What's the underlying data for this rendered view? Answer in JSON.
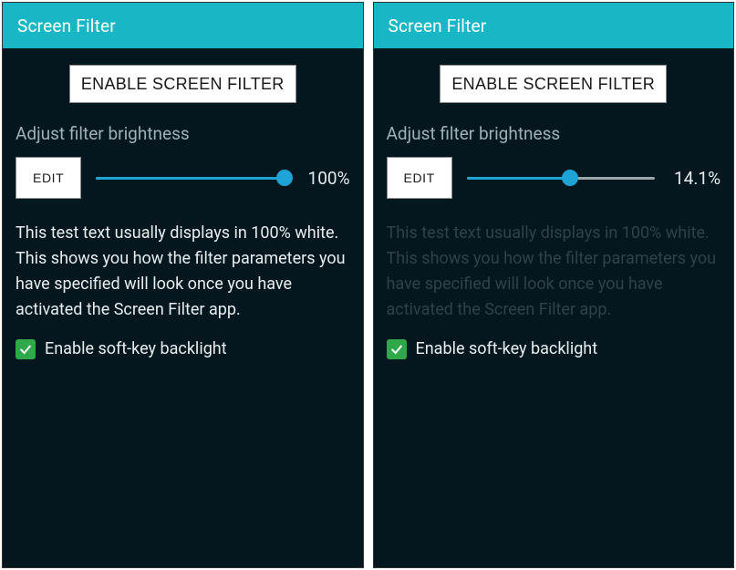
{
  "panels": [
    {
      "title": "Screen Filter",
      "enable_button": "ENABLE SCREEN FILTER",
      "brightness_label": "Adjust filter brightness",
      "edit_button": "EDIT",
      "slider_percent": 100,
      "percent_text": "100%",
      "test_text": "This test text usually displays in 100% white. This shows you how the filter parameters you have specified will look once you have activated the Screen Filter app.",
      "test_text_color": "#e8eef0",
      "checkbox_checked": true,
      "checkbox_label": "Enable soft-key backlight"
    },
    {
      "title": "Screen Filter",
      "enable_button": "ENABLE SCREEN FILTER",
      "brightness_label": "Adjust filter brightness",
      "edit_button": "EDIT",
      "slider_percent": 55,
      "percent_text": "14.1%",
      "test_text": "This test text usually displays in 100% white. This shows you how the filter parameters you have specified will look once you have activated the Screen Filter app.",
      "test_text_color": "#2e4249",
      "checkbox_checked": true,
      "checkbox_label": "Enable soft-key backlight"
    }
  ]
}
